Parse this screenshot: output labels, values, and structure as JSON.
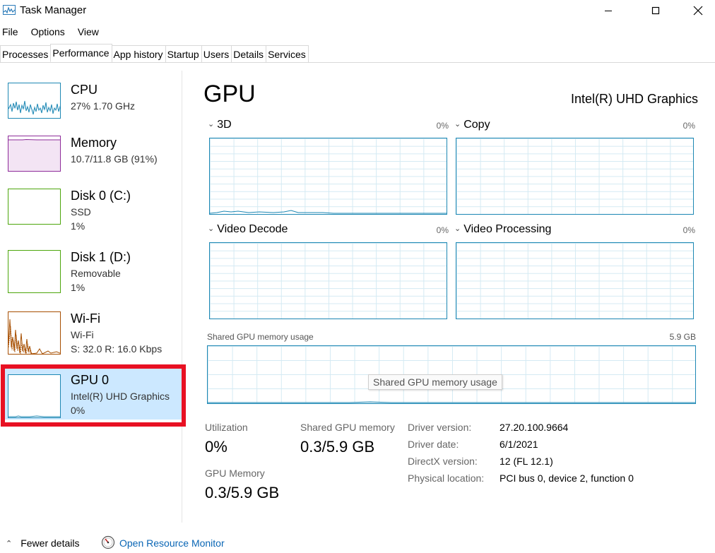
{
  "window": {
    "title": "Task Manager",
    "app_icon": "task-manager-icon",
    "controls": {
      "minimize": "minimize-icon",
      "maximize": "maximize-icon",
      "close": "close-icon"
    }
  },
  "menu": [
    "File",
    "Options",
    "View"
  ],
  "tabs": [
    "Processes",
    "Performance",
    "App history",
    "Startup",
    "Users",
    "Details",
    "Services"
  ],
  "active_tab": "Performance",
  "sidebar": [
    {
      "name": "CPU",
      "line1": "27%  1.70 GHz",
      "line2": "",
      "color": "#1e88b4"
    },
    {
      "name": "Memory",
      "line1": "10.7/11.8 GB (91%)",
      "line2": "",
      "color": "#8e2c9a"
    },
    {
      "name": "Disk 0 (C:)",
      "line1": "SSD",
      "line2": "1%",
      "color": "#4da60c"
    },
    {
      "name": "Disk 1 (D:)",
      "line1": "Removable",
      "line2": "1%",
      "color": "#4da60c"
    },
    {
      "name": "Wi-Fi",
      "line1": "Wi-Fi",
      "line2": "S: 32.0  R: 16.0 Kbps",
      "color": "#a74f01"
    },
    {
      "name": "GPU 0",
      "line1": "Intel(R) UHD Graphics",
      "line2": "0%",
      "color": "#1e88b4",
      "selected": true
    }
  ],
  "main": {
    "title": "GPU",
    "model": "Intel(R) UHD Graphics",
    "engines": [
      {
        "label": "3D",
        "pct": "0%"
      },
      {
        "label": "Copy",
        "pct": "0%"
      },
      {
        "label": "Video Decode",
        "pct": "0%"
      },
      {
        "label": "Video Processing",
        "pct": "0%"
      }
    ],
    "shared_memory": {
      "label": "Shared GPU memory usage",
      "max": "5.9 GB",
      "tooltip": "Shared GPU memory usage"
    },
    "stats": {
      "utilization_label": "Utilization",
      "utilization_value": "0%",
      "shared_label": "Shared GPU memory",
      "shared_value": "0.3/5.9 GB",
      "gpu_mem_label": "GPU Memory",
      "gpu_mem_value": "0.3/5.9 GB"
    },
    "info": [
      {
        "key": "Driver version:",
        "value": "27.20.100.9664"
      },
      {
        "key": "Driver date:",
        "value": "6/1/2021"
      },
      {
        "key": "DirectX version:",
        "value": "12 (FL 12.1)"
      },
      {
        "key": "Physical location:",
        "value": "PCI bus 0, device 2, function 0"
      }
    ]
  },
  "footer": {
    "fewer_details": "Fewer details",
    "open_resource_monitor": "Open Resource Monitor",
    "resource_icon": "resource-monitor-icon"
  }
}
